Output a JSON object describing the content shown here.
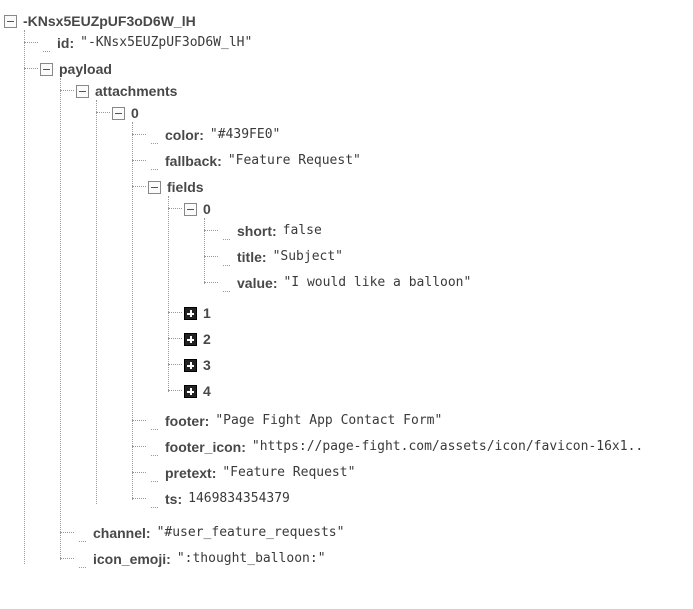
{
  "root": {
    "key": "-KNsx5EUZpUF3oD6W_lH",
    "id_key": "id",
    "id_val": "\"-KNsx5EUZpUF3oD6W_lH\"",
    "payload_key": "payload",
    "attachments_key": "attachments",
    "att0_key": "0",
    "color_key": "color",
    "color_val": "\"#439FE0\"",
    "fallback_key": "fallback",
    "fallback_val": "\"Feature Request\"",
    "fields_key": "fields",
    "f0_key": "0",
    "short_key": "short",
    "short_val": "false",
    "title_key": "title",
    "title_val": "\"Subject\"",
    "value_key": "value",
    "value_val": "\"I would like a balloon\"",
    "f1_key": "1",
    "f2_key": "2",
    "f3_key": "3",
    "f4_key": "4",
    "footer_key": "footer",
    "footer_val": "\"Page Fight App Contact Form\"",
    "footer_icon_key": "footer_icon",
    "footer_icon_val": "\"https://page-fight.com/assets/icon/favicon-16x1..",
    "pretext_key": "pretext",
    "pretext_val": "\"Feature Request\"",
    "ts_key": "ts",
    "ts_val": "1469834354379",
    "channel_key": "channel",
    "channel_val": "\"#user_feature_requests\"",
    "icon_emoji_key": "icon_emoji",
    "icon_emoji_val": "\":thought_balloon:\""
  }
}
